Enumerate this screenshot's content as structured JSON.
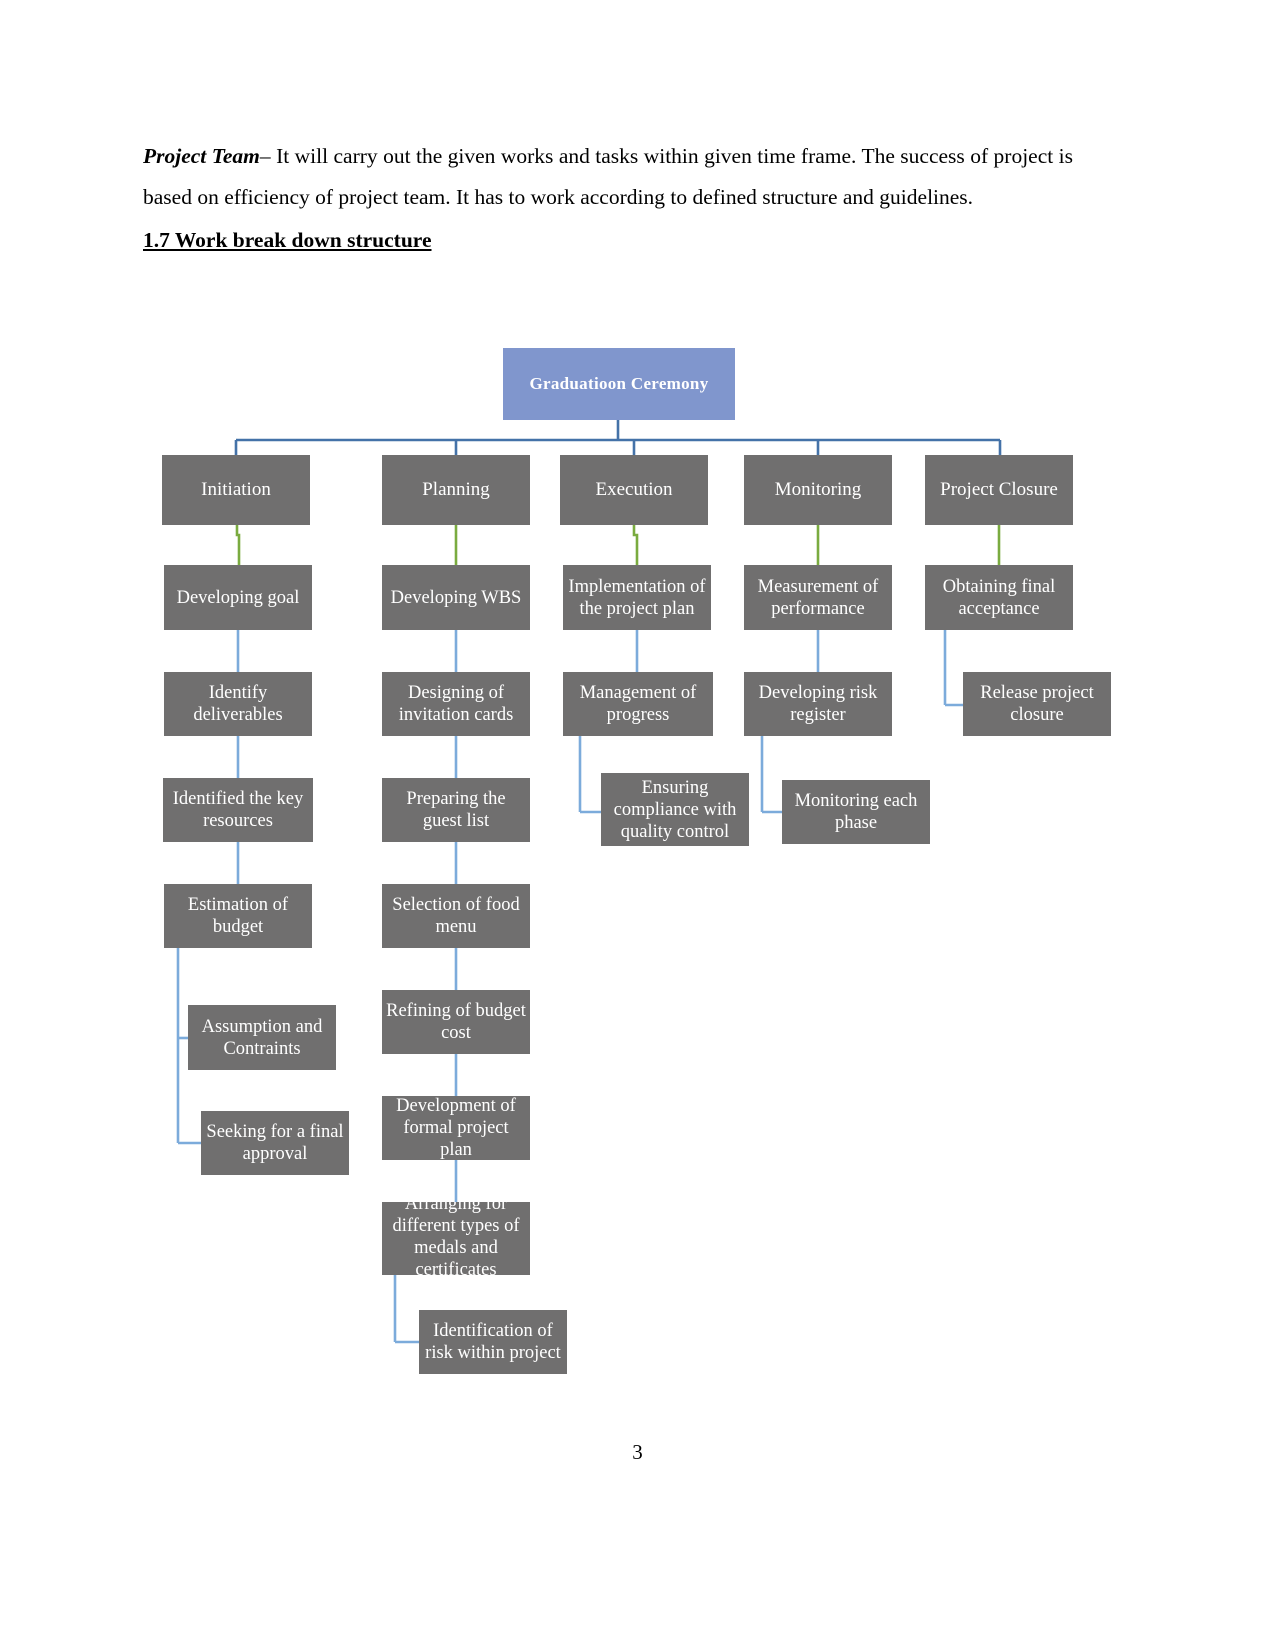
{
  "document": {
    "paragraph": {
      "lead": "Project Team",
      "rest": "– It will carry out the given works and tasks within given time frame. The success of project is based on efficiency of project team. It has to work according to defined structure and guidelines."
    },
    "section_heading": "1.7 Work break down structure",
    "page_number": "3"
  },
  "colors": {
    "root_fill": "#8096cd",
    "node_fill": "#706f6f",
    "node_text": "#ffffff",
    "connector_blue_dark": "#4472a8",
    "connector_green": "#7aab3f",
    "connector_blue_light": "#7cabdb",
    "page_background": "#ffffff"
  },
  "chart_data": {
    "type": "diagram",
    "title": "Graduatioon Ceremony",
    "subtype": "work-breakdown-structure",
    "root": {
      "id": "root",
      "label": "Graduatioon Ceremony"
    },
    "branches": [
      {
        "id": "initiation",
        "label": "Initiation",
        "children": [
          "Developing goal",
          "Identify deliverables",
          "Identified the key resources",
          "Estimation of budget",
          "Assumption and Contraints",
          "Seeking for a final approval"
        ]
      },
      {
        "id": "planning",
        "label": "Planning",
        "children": [
          "Developing WBS",
          "Designing of invitation cards",
          "Preparing the guest list",
          "Selection of food menu",
          "Refining of budget cost",
          "Development of formal project plan",
          "Arranging for different types of medals and certificates",
          "Identification of risk within project"
        ]
      },
      {
        "id": "execution",
        "label": "Execution",
        "children": [
          "Implementation of the project plan",
          "Management of progress",
          "Ensuring compliance with quality control"
        ]
      },
      {
        "id": "monitoring",
        "label": "Monitoring",
        "children": [
          "Measurement of performance",
          "Developing risk register",
          "Monitoring each phase"
        ]
      },
      {
        "id": "project-closure",
        "label": "Project Closure",
        "children": [
          "Obtaining final acceptance",
          "Release project closure"
        ]
      }
    ]
  },
  "nodes": {
    "root": "Graduatioon Ceremony",
    "l2": {
      "initiation": "Initiation",
      "planning": "Planning",
      "execution": "Execution",
      "monitoring": "Monitoring",
      "closure": "Project Closure"
    },
    "initiation": {
      "n1": "Developing goal",
      "n2": "Identify deliverables",
      "n3": "Identified the key resources",
      "n4": "Estimation of budget",
      "n5": "Assumption and Contraints",
      "n6": "Seeking for a final approval"
    },
    "planning": {
      "n1": "Developing WBS",
      "n2": "Designing of invitation cards",
      "n3": "Preparing the guest list",
      "n4": "Selection of food menu",
      "n5": "Refining of budget cost",
      "n6": "Development of formal project plan",
      "n7": "Arranging for different types of medals and certificates",
      "n8": "Identification of risk within project"
    },
    "execution": {
      "n1": "Implementation of the project plan",
      "n2": "Management of progress",
      "n3": "Ensuring compliance with quality control"
    },
    "monitoring": {
      "n1": "Measurement of performance",
      "n2": "Developing risk register",
      "n3": "Monitoring each phase"
    },
    "closure": {
      "n1": "Obtaining final acceptance",
      "n2": "Release project closure"
    }
  }
}
